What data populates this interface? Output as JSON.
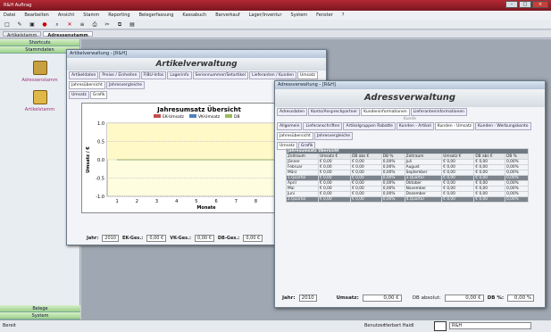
{
  "window": {
    "title": "R&H Auftrag"
  },
  "menu": [
    "Datei",
    "Bearbeiten",
    "Ansicht",
    "Stamm",
    "Reporting",
    "Belegerfassung",
    "Kassabuch",
    "Barverkauf",
    "Lager/Inventur",
    "System",
    "Fenster",
    "?"
  ],
  "doctabs": [
    "Artikelstamm",
    "Adressenstamm"
  ],
  "sidebar": {
    "top": "Shortcuts",
    "sub": "Stammdaten",
    "items": [
      "Adressenstamm",
      "Artikelstamm"
    ],
    "bottom": [
      "Belege",
      "System"
    ]
  },
  "artikel": {
    "title": "Artikelverwaltung - [R&H]",
    "heading": "Artikelverwaltung",
    "tabs": [
      "Artikeldaten",
      "Preise / Einheiten",
      "FIBU-Infos",
      "Lagerinfo",
      "Seriennummer/Setartikel",
      "Lieferanten / Kunden",
      "Umsatz"
    ],
    "subtabs": [
      "Jahresübersicht",
      "Jahresvergleiche"
    ],
    "viewtabs": [
      "Umsatz",
      "Grafik"
    ],
    "footer": {
      "jahr_label": "Jahr:",
      "jahr": "2010",
      "ek_label": "EK-Ges.:",
      "ek": "0,00 €",
      "vk_label": "VK-Ges.:",
      "vk": "0,00 €",
      "db_label": "DB-Ges.:",
      "db": "0,00 €"
    }
  },
  "chart_data": {
    "type": "line",
    "title": "Jahresumsatz Übersicht",
    "xlabel": "Monate",
    "ylabel": "Umsatz / €",
    "x": [
      1,
      2,
      3,
      4,
      5,
      6,
      7,
      8,
      9,
      10
    ],
    "xlim": [
      0.5,
      10.5
    ],
    "ylim": [
      -1,
      1
    ],
    "yticks": [
      -1,
      -0.5,
      0,
      0.5,
      1
    ],
    "legend": "top-center",
    "grid": true,
    "series": [
      {
        "name": "EK-Umsatz",
        "values": [
          0,
          0,
          0,
          0,
          0,
          0,
          0,
          0,
          0,
          0
        ]
      },
      {
        "name": "VK-Umsatz",
        "values": [
          0,
          0,
          0,
          0,
          0,
          0,
          0,
          0,
          0,
          0
        ]
      },
      {
        "name": "DB",
        "values": [
          0,
          0,
          0,
          0,
          0,
          0,
          0,
          0,
          0,
          0
        ]
      }
    ]
  },
  "adress": {
    "title": "Adressverwaltung - [R&H]",
    "heading": "Adressverwaltung",
    "tabs": [
      "Adressdaten",
      "Konto/Ansprechpartner",
      "Kundeninformationen",
      "Lieferanteninformationen"
    ],
    "kunde_label": "Kunde",
    "subtabs": [
      "Allgemein",
      "Lieferanschriften",
      "Artikelgruppen Rabatte",
      "Kunden - Artikel",
      "Kunden - Umsatz",
      "Kunden - Werbungskonto"
    ],
    "yeartabs": [
      "Jahresübersicht",
      "Jahresvergleiche"
    ],
    "viewtabs": [
      "Umsatz",
      "Grafik"
    ],
    "table_caption": "Jahresumsatz Übersicht",
    "columns": [
      "Zeitraum",
      "Umsatz €",
      "DB abs €",
      "DB %",
      "Zeitraum",
      "Umsatz €",
      "DB abs €",
      "DB %"
    ],
    "rows": [
      [
        "Jänner",
        "€ 0,00",
        "€ 0,00",
        "0,00%",
        "Juli",
        "€ 0,00",
        "€ 0,00",
        "0,00%"
      ],
      [
        "Februar",
        "€ 0,00",
        "€ 0,00",
        "0,00%",
        "August",
        "€ 0,00",
        "€ 0,00",
        "0,00%"
      ],
      [
        "März",
        "€ 0,00",
        "€ 0,00",
        "0,00%",
        "September",
        "€ 0,00",
        "€ 0,00",
        "0,00%"
      ],
      [
        "1.Quartal",
        "€ 0,00",
        "€ 0,00",
        "0,00%",
        "3.Quartal",
        "€ 0,00",
        "€ 0,00",
        "0,00%"
      ],
      [
        "April",
        "€ 0,00",
        "€ 0,00",
        "0,00%",
        "Oktober",
        "€ 0,00",
        "€ 0,00",
        "0,00%"
      ],
      [
        "Mai",
        "€ 0,00",
        "€ 0,00",
        "0,00%",
        "November",
        "€ 0,00",
        "€ 0,00",
        "0,00%"
      ],
      [
        "Juni",
        "€ 0,00",
        "€ 0,00",
        "0,00%",
        "Dezember",
        "€ 0,00",
        "€ 0,00",
        "0,00%"
      ],
      [
        "2.Quartal",
        "€ 0,00",
        "€ 0,00",
        "0,00%",
        "4.Quartal",
        "€ 0,00",
        "€ 0,00",
        "0,00%"
      ]
    ],
    "footer": {
      "jahr_label": "Jahr:",
      "jahr": "2010",
      "umsatz_label": "Umsatz:",
      "umsatz": "0,00 €",
      "dbabs_label": "DB absolut:",
      "dbabs": "0,00 €",
      "dbp_label": "DB %:",
      "dbp": "0,00 %"
    }
  },
  "status": {
    "left": "Bereit",
    "user_label": "Benutzer:",
    "user": "Herbert Haidl",
    "company": "R&H"
  }
}
